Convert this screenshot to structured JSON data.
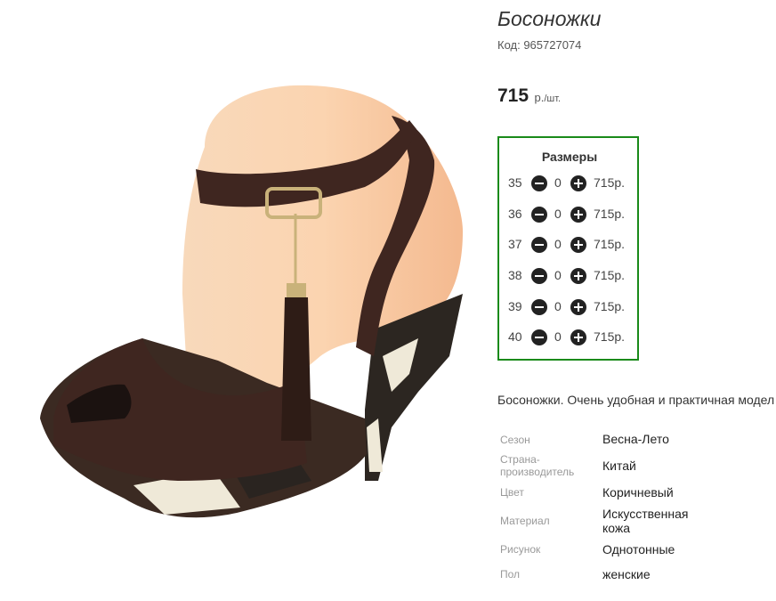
{
  "product": {
    "title": "Босоножки",
    "code": "Код: 965727074",
    "price": "715",
    "price_unit": "р.",
    "price_per": "/шт."
  },
  "sizes": {
    "title": "Размеры",
    "rows": [
      {
        "size": "35",
        "qty": "0",
        "price": "715р."
      },
      {
        "size": "36",
        "qty": "0",
        "price": "715р."
      },
      {
        "size": "37",
        "qty": "0",
        "price": "715р."
      },
      {
        "size": "38",
        "qty": "0",
        "price": "715р."
      },
      {
        "size": "39",
        "qty": "0",
        "price": "715р."
      },
      {
        "size": "40",
        "qty": "0",
        "price": "715р."
      }
    ]
  },
  "description": "Босоножки. Очень удобная и практичная модел",
  "attributes": [
    {
      "label": "Сезон",
      "value": "Весна-Лето"
    },
    {
      "label": "Страна-производитель",
      "value": "Китай"
    },
    {
      "label": "Цвет",
      "value": "Коричневый"
    },
    {
      "label": "Материал",
      "value": "Искусственная кожа"
    },
    {
      "label": "Рисунок",
      "value": "Однотонные"
    },
    {
      "label": "Пол",
      "value": "женские"
    }
  ],
  "colors": {
    "sizes_border": "#1a8a1a",
    "leather": "#3f2620",
    "mannequin": "#f6c9a3"
  }
}
